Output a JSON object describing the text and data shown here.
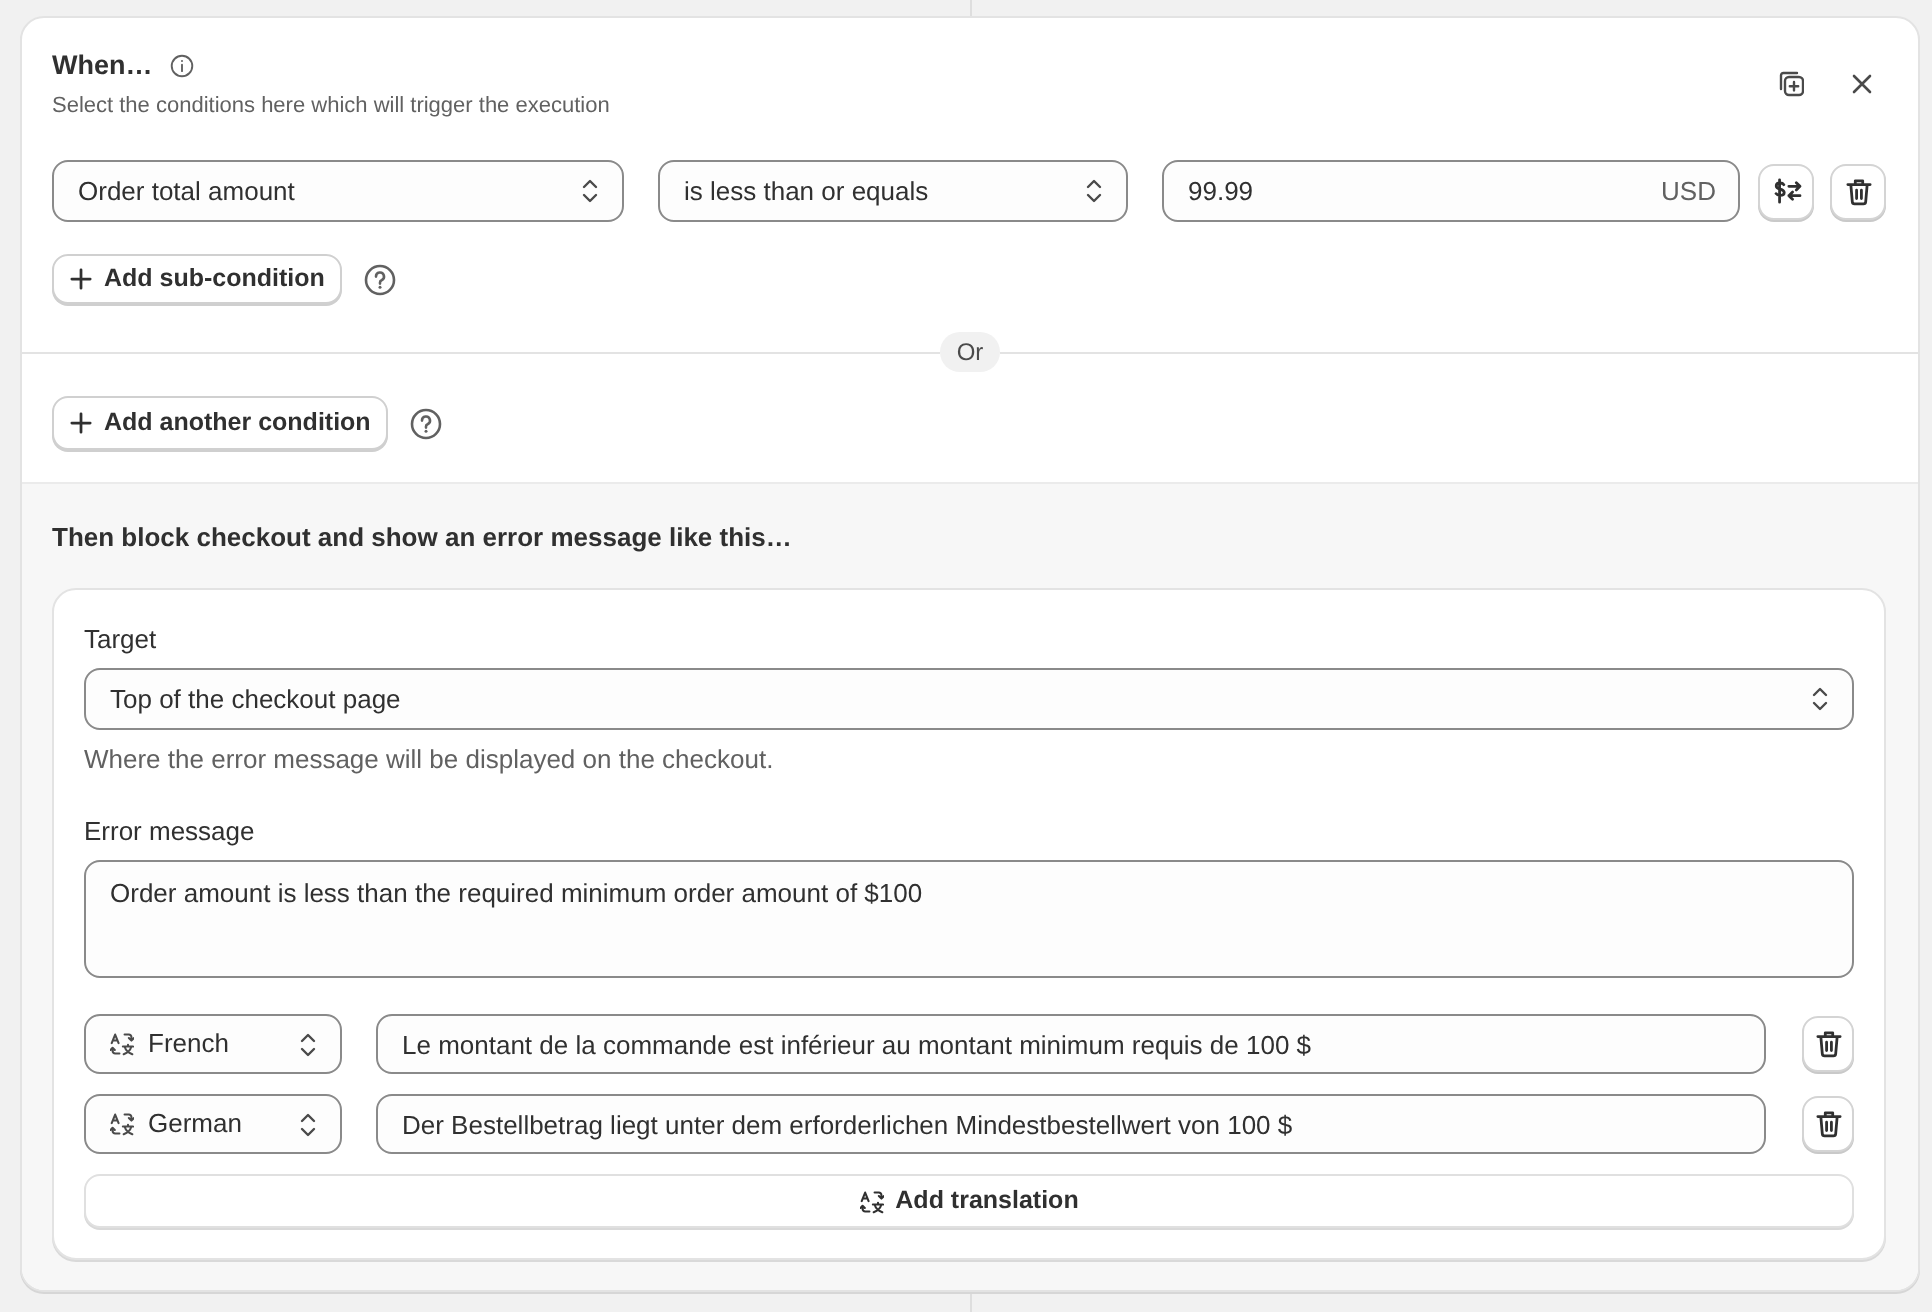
{
  "header": {
    "title": "When…",
    "subtitle": "Select the conditions here which will trigger the execution"
  },
  "conditions": [
    {
      "field": "Order total amount",
      "operator": "is less than or equals",
      "value": "99.99",
      "currency": "USD",
      "add_sub_condition": "Add sub-condition"
    }
  ],
  "separator_label": "Or",
  "add_condition_button": "Add another condition",
  "action": {
    "heading": "Then block checkout and show an error message like this…",
    "target_label": "Target",
    "target": "Top of the checkout page",
    "target_help": "Where the error message will be displayed on the checkout.",
    "message_label": "Error message",
    "message": "Order amount is less than the required minimum order amount of $100",
    "translations": [
      {
        "language": "French",
        "text": "Le montant de la commande est inférieur au montant minimum requis de 100 $"
      },
      {
        "language": "German",
        "text": "Der Bestellbetrag liegt unter dem erforderlichen Mindestbestellwert von 100 $"
      }
    ],
    "add_translation_button": "Add translation"
  }
}
